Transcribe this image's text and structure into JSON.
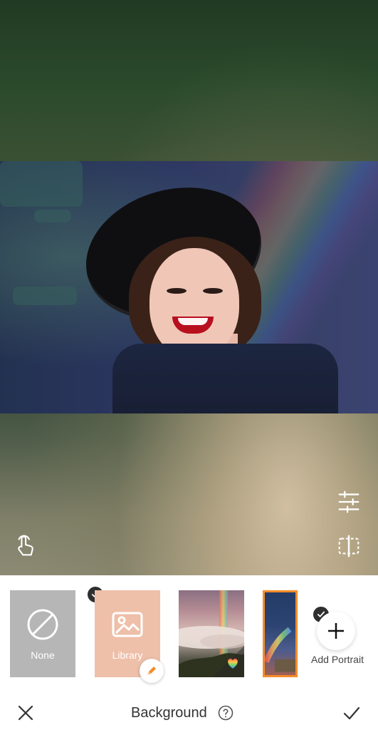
{
  "canvas": {
    "adjust_icon": "sliders-icon",
    "touch_icon": "hand-touch-icon",
    "compare_icon": "split-compare-icon"
  },
  "tray": {
    "options": [
      {
        "label": "None",
        "icon": "prohibited-icon"
      },
      {
        "label": "Library",
        "icon": "image-icon",
        "badge": "pencil-icon"
      },
      {
        "label": "",
        "icon": "rainbow-thumb"
      },
      {
        "label": "",
        "icon": "rainbow-thumb"
      }
    ],
    "add_portrait_label": "Add Portrait",
    "selected_check_icon": "check-icon"
  },
  "bottom_bar": {
    "title": "Background",
    "close_icon": "close-icon",
    "help_icon": "help-icon",
    "confirm_icon": "check-icon"
  },
  "colors": {
    "accent_orange": "#f58c2a",
    "library_tile": "#eebfa9",
    "none_tile": "#b6b6b6"
  }
}
